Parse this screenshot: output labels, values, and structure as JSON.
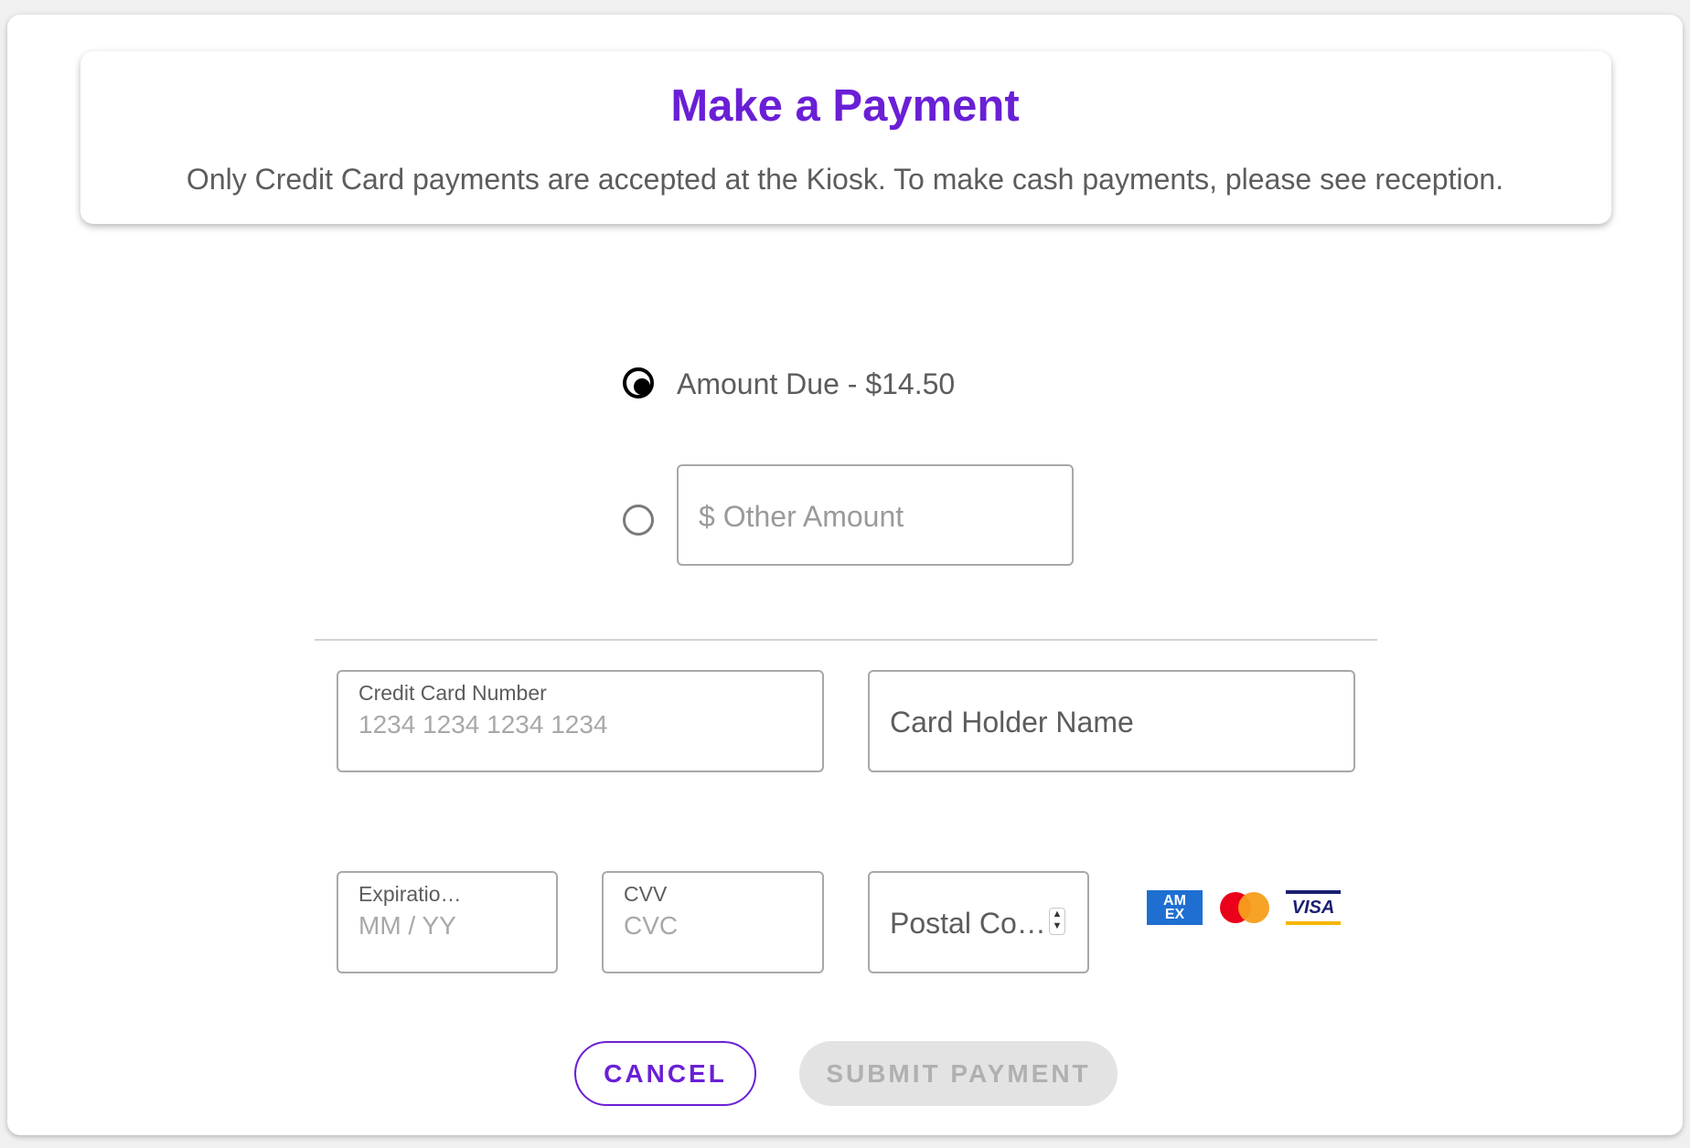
{
  "header": {
    "title": "Make a Payment",
    "subtitle": "Only Credit Card payments are accepted at the Kiosk. To make cash payments, please see reception."
  },
  "amount": {
    "due_label": "Amount Due - $14.50",
    "due_selected": true,
    "other_placeholder": "$ Other Amount",
    "other_selected": false
  },
  "card": {
    "number_label": "Credit Card Number",
    "number_placeholder": "1234 1234 1234 1234",
    "holder_placeholder": "Card Holder Name",
    "expiration_label": "Expiratio…",
    "expiration_placeholder": "MM / YY",
    "cvv_label": "CVV",
    "cvv_placeholder": "CVC",
    "postal_placeholder": "Postal Co…",
    "logos": {
      "amex": "AM EX",
      "mastercard": "mastercard",
      "visa": "VISA"
    }
  },
  "actions": {
    "cancel": "CANCEL",
    "submit": "SUBMIT PAYMENT"
  },
  "colors": {
    "accent": "#6a1fd6",
    "text": "#5c5c5c",
    "placeholder": "#9a9a9a",
    "disabled_bg": "#e3e3e3"
  }
}
